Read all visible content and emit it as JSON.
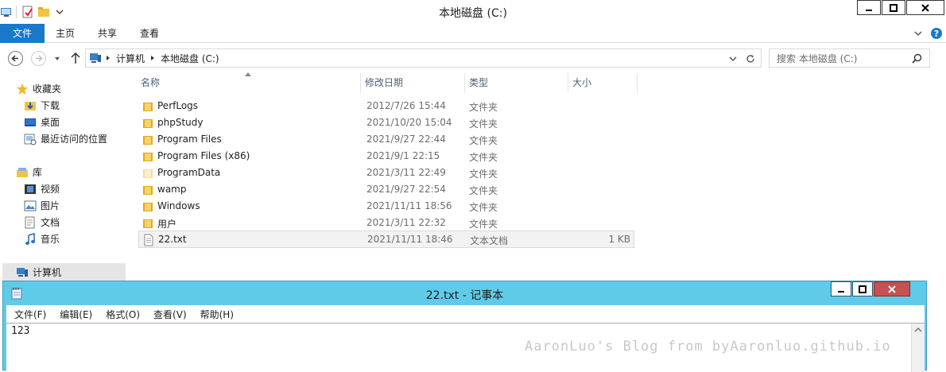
{
  "window": {
    "title": "本地磁盘 (C:)"
  },
  "ribbon": {
    "tabs": [
      "文件",
      "主页",
      "共享",
      "查看"
    ]
  },
  "address": {
    "crumbs": [
      "计算机",
      "本地磁盘 (C:)"
    ],
    "search_placeholder": "搜索 本地磁盘 (C:)"
  },
  "nav": {
    "favorites_label": "收藏夹",
    "favorites": [
      "下载",
      "桌面",
      "最近访问的位置"
    ],
    "libraries_label": "库",
    "libraries": [
      "视频",
      "图片",
      "文档",
      "音乐"
    ],
    "computer_label": "计算机"
  },
  "columns": {
    "name": "名称",
    "date": "修改日期",
    "type": "类型",
    "size": "大小"
  },
  "files": [
    {
      "name": "PerfLogs",
      "date": "2012/7/26 15:44",
      "type": "文件夹",
      "size": "",
      "icon": "folder-icon"
    },
    {
      "name": "phpStudy",
      "date": "2021/10/20 15:04",
      "type": "文件夹",
      "size": "",
      "icon": "folder-icon"
    },
    {
      "name": "Program Files",
      "date": "2021/9/27 22:44",
      "type": "文件夹",
      "size": "",
      "icon": "folder-icon"
    },
    {
      "name": "Program Files (x86)",
      "date": "2021/9/1 22:15",
      "type": "文件夹",
      "size": "",
      "icon": "folder-icon"
    },
    {
      "name": "ProgramData",
      "date": "2021/3/11 22:49",
      "type": "文件夹",
      "size": "",
      "icon": "folder-icon"
    },
    {
      "name": "wamp",
      "date": "2021/9/27 22:54",
      "type": "文件夹",
      "size": "",
      "icon": "folder-icon"
    },
    {
      "name": "Windows",
      "date": "2021/11/11 18:56",
      "type": "文件夹",
      "size": "",
      "icon": "folder-icon"
    },
    {
      "name": "用户",
      "date": "2021/3/11 22:32",
      "type": "文件夹",
      "size": "",
      "icon": "folder-icon"
    },
    {
      "name": "22.txt",
      "date": "2021/11/11 18:46",
      "type": "文本文档",
      "size": "1 KB",
      "icon": "text-file-icon"
    }
  ],
  "notepad": {
    "title": "22.txt - 记事本",
    "menu": [
      "文件(F)",
      "编辑(E)",
      "格式(O)",
      "查看(V)",
      "帮助(H)"
    ],
    "content": "123"
  },
  "watermark": "AaronLuo's Blog from byAaronluo.github.io",
  "colors": {
    "ribbon_active": "#1979ca",
    "notepad_frame": "#60cbe9",
    "close_red": "#c75050"
  }
}
